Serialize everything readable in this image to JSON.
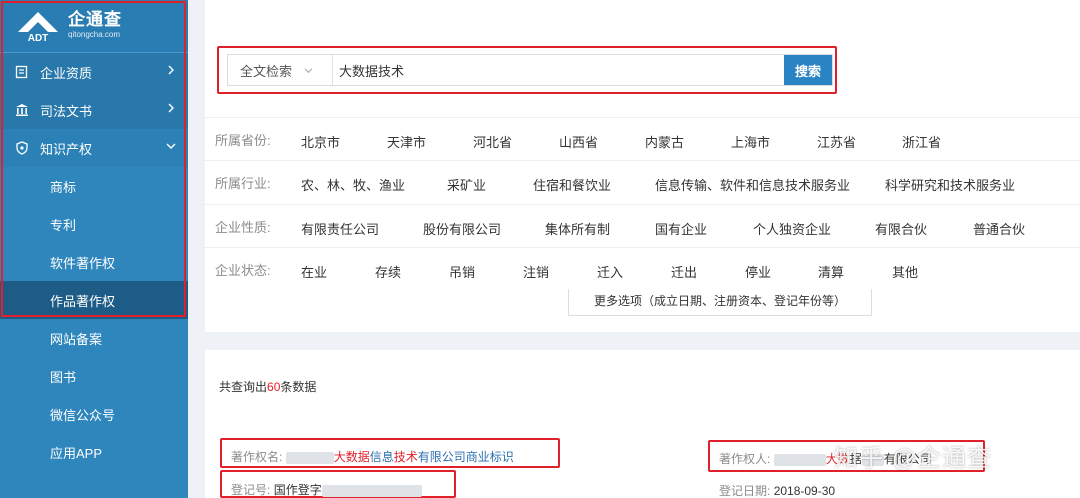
{
  "logo": {
    "brand": "企通查",
    "domain": "qitongcha.com",
    "mark_text": "ADT"
  },
  "sidebar": {
    "items": [
      {
        "label": "企业资质",
        "icon": "certificate-icon"
      },
      {
        "label": "司法文书",
        "icon": "courthouse-icon"
      },
      {
        "label": "知识产权",
        "icon": "shield-icon"
      }
    ],
    "sub_items": [
      "商标",
      "专利",
      "软件著作权",
      "作品著作权",
      "网站备案",
      "图书",
      "微信公众号",
      "应用APP"
    ],
    "active_item": "作品著作权"
  },
  "search": {
    "type_label": "全文检索",
    "value": "大数据技术",
    "button_label": "搜索"
  },
  "filters": {
    "province": {
      "label": "所属省份:",
      "options": [
        "北京市",
        "天津市",
        "河北省",
        "山西省",
        "内蒙古",
        "上海市",
        "江苏省",
        "浙江省"
      ]
    },
    "industry": {
      "label": "所属行业:",
      "options": [
        "农、林、牧、渔业",
        "采矿业",
        "住宿和餐饮业",
        "信息传输、软件和信息技术服务业",
        "科学研究和技术服务业"
      ]
    },
    "nature": {
      "label": "企业性质:",
      "options": [
        "有限责任公司",
        "股份有限公司",
        "集体所有制",
        "国有企业",
        "个人独资企业",
        "有限合伙",
        "普通合伙"
      ]
    },
    "status": {
      "label": "企业状态:",
      "options": [
        "在业",
        "存续",
        "吊销",
        "注销",
        "迁入",
        "迁出",
        "停业",
        "清算",
        "其他"
      ]
    },
    "more_options": "更多选项（成立日期、注册资本、登记年份等）"
  },
  "results": {
    "count_prefix": "共查询出",
    "count": "60",
    "count_suffix": "条数据",
    "item": {
      "work_name_label": "著作权名:",
      "work_name_hl1": "大数据",
      "work_name_mid": "信息",
      "work_name_hl2": "技术",
      "work_name_rest": "有限公司商业标识",
      "owner_label": "著作权人:",
      "owner_hl": "大数",
      "owner_rest": "据",
      "owner_tail": "有限公司",
      "reg_no_label": "登记号:",
      "reg_no_prefix": "国作登字",
      "reg_date_label": "登记日期:",
      "reg_date": "2018-09-30"
    }
  },
  "watermark": "知乎 @企通查",
  "colors": {
    "sidebar": "#2e86bd",
    "active": "#1c5c86",
    "accent": "#e0202a",
    "button": "#2a84c4"
  }
}
